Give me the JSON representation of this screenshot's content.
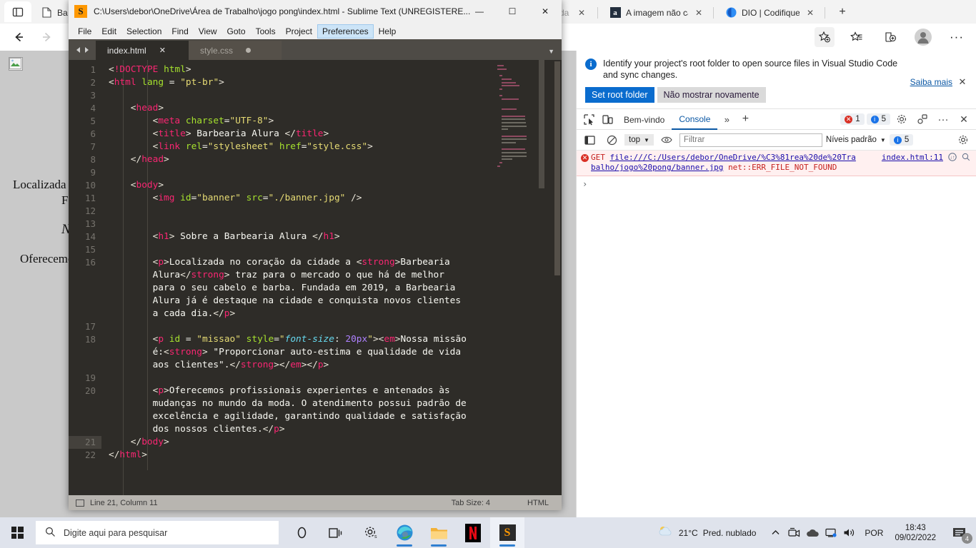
{
  "browser": {
    "tabs": [
      {
        "title": "Ba",
        "favicon": "document-icon"
      },
      {
        "title": "trada",
        "favicon": "none"
      },
      {
        "title": "A imagem não ca",
        "favicon": "amazon-icon"
      },
      {
        "title": "DIO | Codifique o",
        "favicon": "dio-icon"
      }
    ],
    "new_tab_label": "+",
    "toolbar_icons": [
      "back-arrow",
      "forward-arrow",
      "favorite-add-icon",
      "favorites-icon",
      "collections-icon",
      "profile-icon",
      "settings-more-icon"
    ],
    "page_text": [
      "Localizada",
      "F",
      "N",
      "Oferecemo"
    ]
  },
  "devtools": {
    "notification": {
      "message": "Identify your project's root folder to open source files in Visual Studio Code and sync changes.",
      "learn_more": "Saiba mais",
      "primary_button": "Set root folder",
      "secondary_button": "Não mostrar novamente"
    },
    "tabs": [
      {
        "label": "Bem-vindo",
        "active": false
      },
      {
        "label": "Console",
        "active": true
      }
    ],
    "overflow_label": "»",
    "add_tab_label": "+",
    "error_count": "1",
    "info_count": "5",
    "toolbar": {
      "context": "top",
      "filter_placeholder": "Filtrar",
      "levels": "Níveis padrão",
      "levels_count": "5"
    },
    "console_messages": [
      {
        "method": "GET",
        "url_line1": "file:///C:/Users/debor/OneDrive/%C3%81rea%20de%20Tra",
        "url_line2": "balho/jogo%20pong/banner.jpg",
        "error": "net::ERR_FILE_NOT_FOUND",
        "source": "index.html:11"
      }
    ],
    "prompt": "›"
  },
  "sublime": {
    "title": "C:\\Users\\debor\\OneDrive\\Área de Trabalho\\jogo pong\\index.html - Sublime Text (UNREGISTERE...",
    "window_buttons": {
      "minimize": "—",
      "maximize": "☐",
      "close": "✕"
    },
    "menu": [
      "File",
      "Edit",
      "Selection",
      "Find",
      "View",
      "Goto",
      "Tools",
      "Project",
      "Preferences",
      "Help"
    ],
    "active_menu": "Preferences",
    "file_tabs": [
      {
        "name": "index.html",
        "active": true,
        "indicator": "close"
      },
      {
        "name": "style.css",
        "active": false,
        "indicator": "dirty"
      }
    ],
    "status": {
      "position": "Line 21, Column 11",
      "tab_size": "Tab Size: 4",
      "syntax": "HTML"
    },
    "cursor_line": 21,
    "code_lines": [
      {
        "n": 1,
        "segments": [
          {
            "t": "ang",
            "v": "<"
          },
          {
            "t": "dt",
            "v": "!DOCTYPE"
          },
          {
            "t": "txt",
            "v": " "
          },
          {
            "t": "attr",
            "v": "html"
          },
          {
            "t": "ang",
            "v": ">"
          }
        ]
      },
      {
        "n": 2,
        "segments": [
          {
            "t": "ang",
            "v": "<"
          },
          {
            "t": "tag",
            "v": "html"
          },
          {
            "t": "txt",
            "v": " "
          },
          {
            "t": "attr",
            "v": "lang"
          },
          {
            "t": "txt",
            "v": " = "
          },
          {
            "t": "str",
            "v": "\"pt-br\""
          },
          {
            "t": "ang",
            "v": ">"
          }
        ]
      },
      {
        "n": 3,
        "segments": []
      },
      {
        "n": 4,
        "indent": 1,
        "segments": [
          {
            "t": "ang",
            "v": "<"
          },
          {
            "t": "tag",
            "v": "head"
          },
          {
            "t": "ang",
            "v": ">"
          }
        ]
      },
      {
        "n": 5,
        "indent": 2,
        "segments": [
          {
            "t": "ang",
            "v": "<"
          },
          {
            "t": "tag",
            "v": "meta"
          },
          {
            "t": "txt",
            "v": " "
          },
          {
            "t": "attr",
            "v": "charset"
          },
          {
            "t": "txt",
            "v": "="
          },
          {
            "t": "str",
            "v": "\"UTF-8\""
          },
          {
            "t": "ang",
            "v": ">"
          }
        ]
      },
      {
        "n": 6,
        "indent": 2,
        "segments": [
          {
            "t": "ang",
            "v": "<"
          },
          {
            "t": "tag",
            "v": "title"
          },
          {
            "t": "ang",
            "v": ">"
          },
          {
            "t": "txt",
            "v": " Barbearia Alura "
          },
          {
            "t": "ang",
            "v": "</"
          },
          {
            "t": "tag",
            "v": "title"
          },
          {
            "t": "ang",
            "v": ">"
          }
        ]
      },
      {
        "n": 7,
        "indent": 2,
        "segments": [
          {
            "t": "ang",
            "v": "<"
          },
          {
            "t": "tag",
            "v": "link"
          },
          {
            "t": "txt",
            "v": " "
          },
          {
            "t": "attr",
            "v": "rel"
          },
          {
            "t": "txt",
            "v": "="
          },
          {
            "t": "str",
            "v": "\"stylesheet\""
          },
          {
            "t": "txt",
            "v": " "
          },
          {
            "t": "attr",
            "v": "href"
          },
          {
            "t": "txt",
            "v": "="
          },
          {
            "t": "str",
            "v": "\"style.css\""
          },
          {
            "t": "ang",
            "v": ">"
          }
        ]
      },
      {
        "n": 8,
        "indent": 1,
        "segments": [
          {
            "t": "ang",
            "v": "</"
          },
          {
            "t": "tag",
            "v": "head"
          },
          {
            "t": "ang",
            "v": ">"
          }
        ]
      },
      {
        "n": 9,
        "segments": []
      },
      {
        "n": 10,
        "indent": 1,
        "segments": [
          {
            "t": "ang",
            "v": "<"
          },
          {
            "t": "tag",
            "v": "body"
          },
          {
            "t": "ang",
            "v": ">"
          }
        ]
      },
      {
        "n": 11,
        "indent": 2,
        "segments": [
          {
            "t": "ang",
            "v": "<"
          },
          {
            "t": "tag",
            "v": "img"
          },
          {
            "t": "txt",
            "v": " "
          },
          {
            "t": "attr",
            "v": "id"
          },
          {
            "t": "txt",
            "v": "="
          },
          {
            "t": "str",
            "v": "\"banner\""
          },
          {
            "t": "txt",
            "v": " "
          },
          {
            "t": "attr",
            "v": "src"
          },
          {
            "t": "txt",
            "v": "="
          },
          {
            "t": "str",
            "v": "\"./banner.jpg\""
          },
          {
            "t": "txt",
            "v": " "
          },
          {
            "t": "ang",
            "v": "/>"
          }
        ]
      },
      {
        "n": 12,
        "segments": []
      },
      {
        "n": 13,
        "segments": []
      },
      {
        "n": 14,
        "indent": 2,
        "segments": [
          {
            "t": "ang",
            "v": "<"
          },
          {
            "t": "tag",
            "v": "h1"
          },
          {
            "t": "ang",
            "v": ">"
          },
          {
            "t": "txt",
            "v": " Sobre a Barbearia Alura "
          },
          {
            "t": "ang",
            "v": "</"
          },
          {
            "t": "tag",
            "v": "h1"
          },
          {
            "t": "ang",
            "v": ">"
          }
        ]
      },
      {
        "n": 15,
        "segments": []
      },
      {
        "n": 16,
        "indent": 2,
        "wrapped": [
          [
            {
              "t": "ang",
              "v": "<"
            },
            {
              "t": "tag",
              "v": "p"
            },
            {
              "t": "ang",
              "v": ">"
            },
            {
              "t": "txt",
              "v": "Localizada no coração da cidade a "
            },
            {
              "t": "ang",
              "v": "<"
            },
            {
              "t": "tag",
              "v": "strong"
            },
            {
              "t": "ang",
              "v": ">"
            },
            {
              "t": "txt",
              "v": "Barbearia"
            }
          ],
          [
            {
              "t": "txt",
              "v": "Alura"
            },
            {
              "t": "ang",
              "v": "</"
            },
            {
              "t": "tag",
              "v": "strong"
            },
            {
              "t": "ang",
              "v": ">"
            },
            {
              "t": "txt",
              "v": " traz para o mercado o que há de melhor"
            }
          ],
          [
            {
              "t": "txt",
              "v": "para o seu cabelo e barba. Fundada em 2019, a Barbearia"
            }
          ],
          [
            {
              "t": "txt",
              "v": "Alura já é destaque na cidade e conquista novos clientes"
            }
          ],
          [
            {
              "t": "txt",
              "v": "a cada dia."
            },
            {
              "t": "ang",
              "v": "</"
            },
            {
              "t": "tag",
              "v": "p"
            },
            {
              "t": "ang",
              "v": ">"
            }
          ]
        ]
      },
      {
        "n": 17,
        "segments": []
      },
      {
        "n": 18,
        "indent": 2,
        "wrapped": [
          [
            {
              "t": "ang",
              "v": "<"
            },
            {
              "t": "tag",
              "v": "p"
            },
            {
              "t": "txt",
              "v": " "
            },
            {
              "t": "attr",
              "v": "id"
            },
            {
              "t": "txt",
              "v": " = "
            },
            {
              "t": "str",
              "v": "\"missao\""
            },
            {
              "t": "txt",
              "v": " "
            },
            {
              "t": "attr",
              "v": "style"
            },
            {
              "t": "txt",
              "v": "="
            },
            {
              "t": "str",
              "v": "\""
            },
            {
              "t": "cssp",
              "v": "font-size"
            },
            {
              "t": "txt",
              "v": ": "
            },
            {
              "t": "num",
              "v": "20px"
            },
            {
              "t": "str",
              "v": "\""
            },
            {
              "t": "ang",
              "v": ">"
            },
            {
              "t": "ang",
              "v": "<"
            },
            {
              "t": "tag",
              "v": "em"
            },
            {
              "t": "ang",
              "v": ">"
            },
            {
              "t": "txt",
              "v": "Nossa missão"
            }
          ],
          [
            {
              "t": "txt",
              "v": "é:"
            },
            {
              "t": "ang",
              "v": "<"
            },
            {
              "t": "tag",
              "v": "strong"
            },
            {
              "t": "ang",
              "v": ">"
            },
            {
              "t": "txt",
              "v": " \"Proporcionar auto-estima e qualidade de vida"
            }
          ],
          [
            {
              "t": "txt",
              "v": "aos clientes\"."
            },
            {
              "t": "ang",
              "v": "</"
            },
            {
              "t": "tag",
              "v": "strong"
            },
            {
              "t": "ang",
              "v": ">"
            },
            {
              "t": "ang",
              "v": "</"
            },
            {
              "t": "tag",
              "v": "em"
            },
            {
              "t": "ang",
              "v": ">"
            },
            {
              "t": "ang",
              "v": "</"
            },
            {
              "t": "tag",
              "v": "p"
            },
            {
              "t": "ang",
              "v": ">"
            }
          ]
        ]
      },
      {
        "n": 19,
        "segments": []
      },
      {
        "n": 20,
        "indent": 2,
        "wrapped": [
          [
            {
              "t": "ang",
              "v": "<"
            },
            {
              "t": "tag",
              "v": "p"
            },
            {
              "t": "ang",
              "v": ">"
            },
            {
              "t": "txt",
              "v": "Oferecemos profissionais experientes e antenados às"
            }
          ],
          [
            {
              "t": "txt",
              "v": "mudanças no mundo da moda. O atendimento possui padrão de"
            }
          ],
          [
            {
              "t": "txt",
              "v": "excelência e agilidade, garantindo qualidade e satisfação"
            }
          ],
          [
            {
              "t": "txt",
              "v": "dos nossos clientes."
            },
            {
              "t": "ang",
              "v": "</"
            },
            {
              "t": "tag",
              "v": "p"
            },
            {
              "t": "ang",
              "v": ">"
            }
          ]
        ]
      },
      {
        "n": 21,
        "indent": 1,
        "segments": [
          {
            "t": "ang",
            "v": "</"
          },
          {
            "t": "tag",
            "v": "body"
          },
          {
            "t": "ang",
            "v": ">"
          }
        ]
      },
      {
        "n": 22,
        "segments": [
          {
            "t": "ang",
            "v": "</"
          },
          {
            "t": "tag",
            "v": "html"
          },
          {
            "t": "ang",
            "v": ">"
          }
        ]
      }
    ]
  },
  "taskbar": {
    "search_placeholder": "Digite aqui para pesquisar",
    "apps": [
      "cortana-icon",
      "task-view-icon",
      "settings-icon",
      "edge-icon",
      "file-explorer-icon",
      "netflix-icon",
      "sublime-text-icon"
    ],
    "weather": {
      "temperature": "21°C",
      "condition": "Pred. nublado"
    },
    "language": "POR",
    "time": "18:43",
    "date": "09/02/2022",
    "notification_count": "4"
  },
  "colors": {
    "accent_blue": "#0a6cce",
    "error_red": "#d93025",
    "sublime_bg": "#2e2c28",
    "sublime_tag": "#f92672",
    "sublime_attr": "#a6e22e",
    "sublime_string": "#e6db74",
    "sublime_number": "#ae81ff"
  }
}
